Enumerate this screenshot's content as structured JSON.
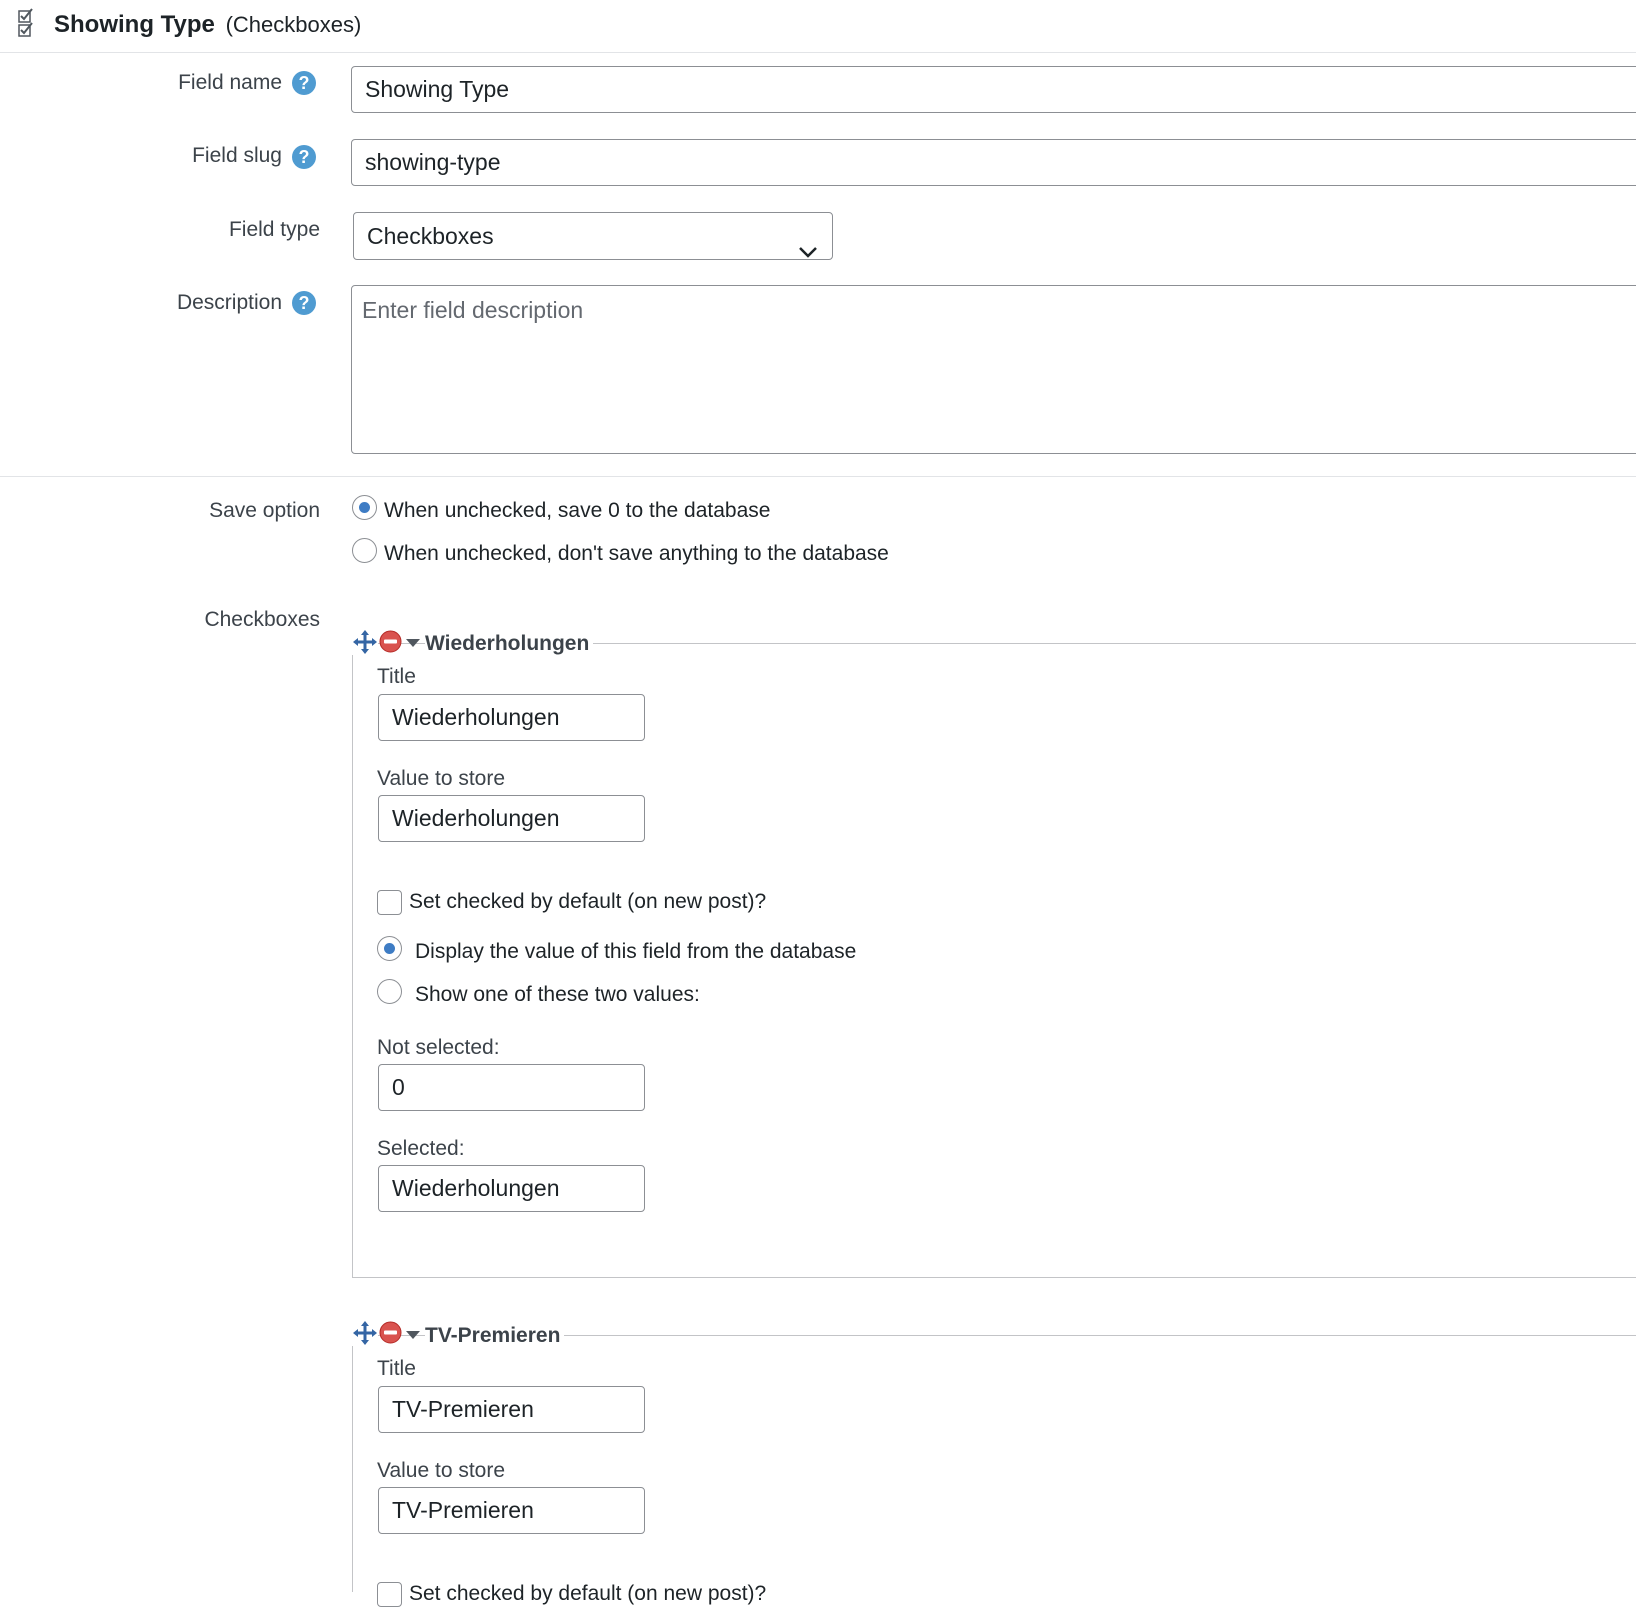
{
  "header": {
    "icon": "checkboxes-icon",
    "field_title": "Showing Type",
    "field_type_suffix": "(Checkboxes)"
  },
  "form": {
    "field_name_label": "Field name",
    "field_name_value": "Showing Type",
    "field_slug_label": "Field slug",
    "field_slug_value": "showing-type",
    "field_type_label": "Field type",
    "field_type_value": "Checkboxes",
    "description_label": "Description",
    "description_placeholder": "Enter field description",
    "help_glyph": "?",
    "save_option_label": "Save option",
    "save_options": [
      {
        "label": "When unchecked, save 0 to the database",
        "selected": true
      },
      {
        "label": "When unchecked, don't save anything to the database",
        "selected": false
      }
    ],
    "checkboxes_label": "Checkboxes"
  },
  "checkbox_items": [
    {
      "legend": "Wiederholungen",
      "title_label": "Title",
      "title_value": "Wiederholungen",
      "value_label": "Value to store",
      "value_value": "Wiederholungen",
      "default_label": "Set checked by default (on new post)?",
      "default_checked": false,
      "display_db_label": "Display the value of this field from the database",
      "display_db_selected": true,
      "show_two_label": "Show one of these two values:",
      "show_two_selected": false,
      "not_selected_label": "Not selected:",
      "not_selected_value": "0",
      "selected_label": "Selected:",
      "selected_value": "Wiederholungen"
    },
    {
      "legend": "TV-Premieren",
      "title_label": "Title",
      "title_value": "TV-Premieren",
      "value_label": "Value to store",
      "value_value": "TV-Premieren",
      "default_label": "Set checked by default (on new post)?",
      "default_checked": false
    }
  ],
  "colors": {
    "accent": "#3e7cc4",
    "help": "#4f9bd1",
    "delete": "#d9534f",
    "move": "#3465a4"
  }
}
